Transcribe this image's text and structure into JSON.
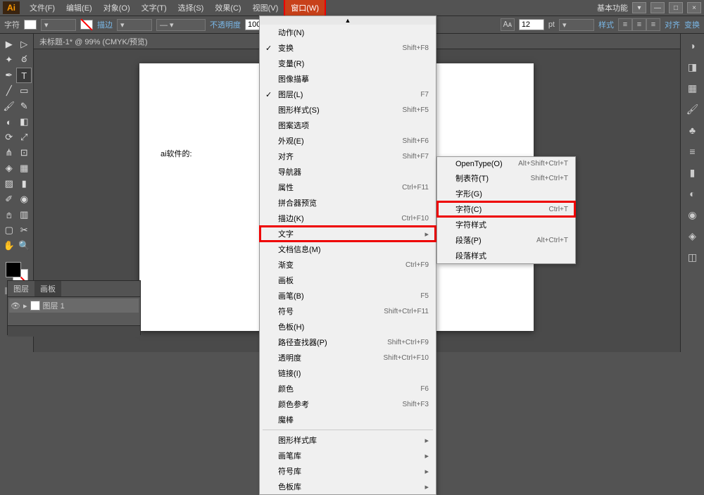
{
  "app": {
    "logo": "Ai"
  },
  "menubar": {
    "items": [
      "文件(F)",
      "编辑(E)",
      "对象(O)",
      "文字(T)",
      "选择(S)",
      "效果(C)",
      "视图(V)",
      "窗口(W)"
    ],
    "active_index": 7,
    "right_label": "基本功能"
  },
  "controlbar": {
    "label": "字符",
    "stroke": "描边",
    "opacity_label": "不透明度",
    "opacity_value": "100",
    "pt_value": "12",
    "pt_unit": "pt",
    "style_label": "样式",
    "align_label": "对齐",
    "transform_label": "变换"
  },
  "doc": {
    "tab_title": "未标题-1* @ 99% (CMYK/预览)",
    "artboard_text": "ai软件的:"
  },
  "window_menu": {
    "scroll_indicator": "▲",
    "items": [
      {
        "label": "动作(N)",
        "shortcut": ""
      },
      {
        "label": "变换",
        "shortcut": "Shift+F8",
        "checked": true
      },
      {
        "label": "变量(R)",
        "shortcut": ""
      },
      {
        "label": "图像描摹",
        "shortcut": ""
      },
      {
        "label": "图层(L)",
        "shortcut": "F7",
        "checked": true
      },
      {
        "label": "图形样式(S)",
        "shortcut": "Shift+F5"
      },
      {
        "label": "图案选项",
        "shortcut": ""
      },
      {
        "label": "外观(E)",
        "shortcut": "Shift+F6"
      },
      {
        "label": "对齐",
        "shortcut": "Shift+F7"
      },
      {
        "label": "导航器",
        "shortcut": ""
      },
      {
        "label": "属性",
        "shortcut": "Ctrl+F11"
      },
      {
        "label": "拼合器预览",
        "shortcut": ""
      },
      {
        "label": "描边(K)",
        "shortcut": "Ctrl+F10"
      },
      {
        "label": "文字",
        "shortcut": "",
        "highlighted": true,
        "submenu": true
      },
      {
        "label": "文档信息(M)",
        "shortcut": ""
      },
      {
        "label": "渐变",
        "shortcut": "Ctrl+F9"
      },
      {
        "label": "画板",
        "shortcut": ""
      },
      {
        "label": "画笔(B)",
        "shortcut": "F5"
      },
      {
        "label": "符号",
        "shortcut": "Shift+Ctrl+F11"
      },
      {
        "label": "色板(H)",
        "shortcut": ""
      },
      {
        "label": "路径查找器(P)",
        "shortcut": "Shift+Ctrl+F9"
      },
      {
        "label": "透明度",
        "shortcut": "Shift+Ctrl+F10"
      },
      {
        "label": "链接(I)",
        "shortcut": ""
      },
      {
        "label": "颜色",
        "shortcut": "F6"
      },
      {
        "label": "颜色参考",
        "shortcut": "Shift+F3"
      },
      {
        "label": "魔棒",
        "shortcut": ""
      },
      {
        "sep": true
      },
      {
        "label": "图形样式库",
        "shortcut": "",
        "submenu": true
      },
      {
        "label": "画笔库",
        "shortcut": "",
        "submenu": true
      },
      {
        "label": "符号库",
        "shortcut": "",
        "submenu": true
      },
      {
        "label": "色板库",
        "shortcut": "",
        "submenu": true
      }
    ]
  },
  "text_submenu": {
    "items": [
      {
        "label": "OpenType(O)",
        "shortcut": "Alt+Shift+Ctrl+T"
      },
      {
        "label": "制表符(T)",
        "shortcut": "Shift+Ctrl+T"
      },
      {
        "label": "字形(G)",
        "shortcut": ""
      },
      {
        "label": "字符(C)",
        "shortcut": "Ctrl+T",
        "highlighted": true
      },
      {
        "label": "字符样式",
        "shortcut": ""
      },
      {
        "label": "段落(P)",
        "shortcut": "Alt+Ctrl+T"
      },
      {
        "label": "段落样式",
        "shortcut": ""
      }
    ]
  },
  "layers": {
    "tab1": "图层",
    "tab2": "画板",
    "row_name": "图层 1"
  }
}
